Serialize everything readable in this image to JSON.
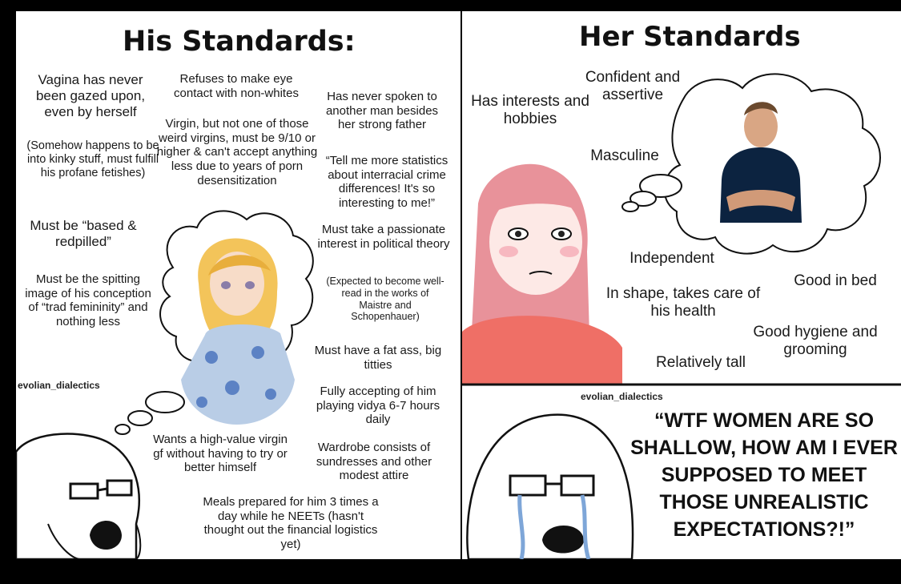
{
  "his": {
    "title": "His Standards:",
    "items": {
      "vagina": "Vagina has never been gazed upon, even by herself",
      "kinky": "(Somehow happens to be into kinky stuff, must fulfill his profane fetishes)",
      "based": "Must be “based & redpilled”",
      "spitting": "Must be the spitting image of his conception of “trad femininity” and nothing less",
      "eye": "Refuses to make eye contact with non-whites",
      "virgin": "Virgin, but not one of those weird virgins, must be 9/10 or higher & can't accept anything less due to years of porn desensitization",
      "spoken": "Has never spoken to another man besides her strong father",
      "stats": "“Tell me more statistics about interracial crime differences! It's so interesting to me!”",
      "political": "Must take a passionate interest in political theory",
      "maistre": "(Expected to become well-read in the works of Maistre and Schopenhauer)",
      "fat": "Must have a fat ass, big titties",
      "vidya": "Fully accepting of him playing vidya 6-7 hours daily",
      "wardrobe": "Wardrobe consists of sundresses and other modest attire",
      "highvalue": "Wants a high-value virgin gf without having to try or better himself",
      "meals": "Meals prepared for him 3 times a day while he NEETs (hasn't thought out the financial logistics yet)"
    },
    "watermark": "evolian_dialectics"
  },
  "her": {
    "title": "Her Standards",
    "items": {
      "interests": "Has interests and hobbies",
      "confident": "Confident and assertive",
      "masculine": "Masculine",
      "independent": "Independent",
      "shape": "In shape, takes care of his health",
      "goodbed": "Good in bed",
      "hygiene": "Good hygiene and grooming",
      "tall": "Relatively tall"
    },
    "watermark": "evolian_dialectics",
    "quote": "“WTF WOMEN ARE SO SHALLOW, HOW AM I EVER SUPPOSED TO MEET THOSE UNREALISTIC EXPECTATIONS?!”"
  }
}
